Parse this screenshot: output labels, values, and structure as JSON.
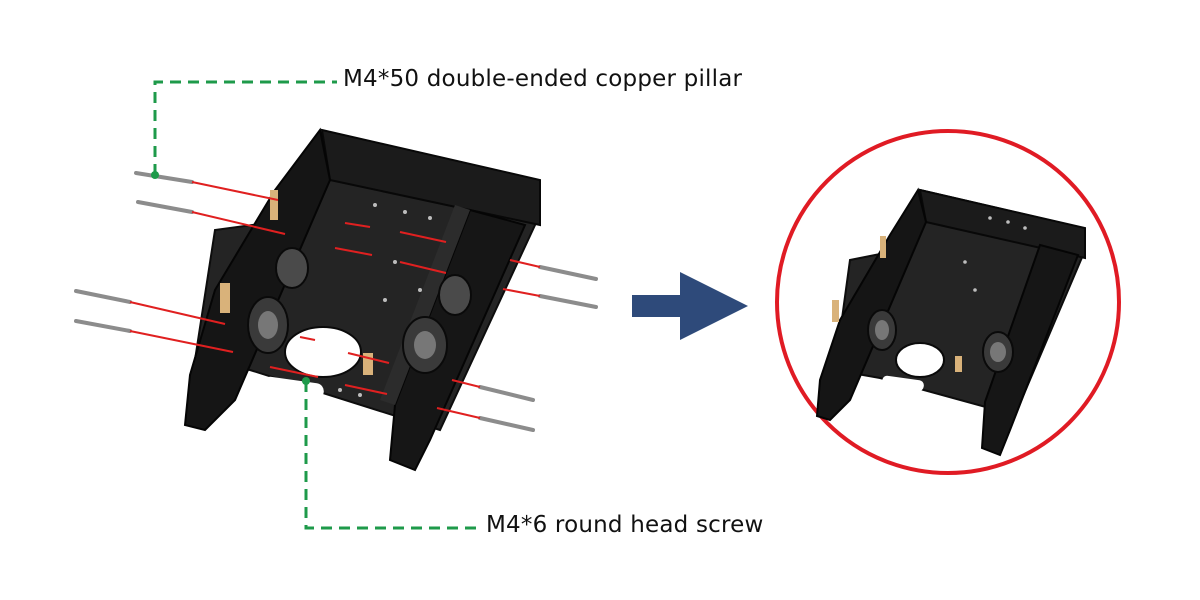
{
  "labels": {
    "pillar": "M4*50 double-ended copper pillar",
    "screw": "M4*6 round head screw"
  },
  "colors": {
    "callout_line": "#1e9a4a",
    "assembly_line": "#e02020",
    "arrow": "#2e4a7a",
    "circle": "#e01b24",
    "chassis": "#1a1a1a",
    "standoff": "#d9b27a"
  },
  "icons": [
    "right-arrow-icon"
  ]
}
